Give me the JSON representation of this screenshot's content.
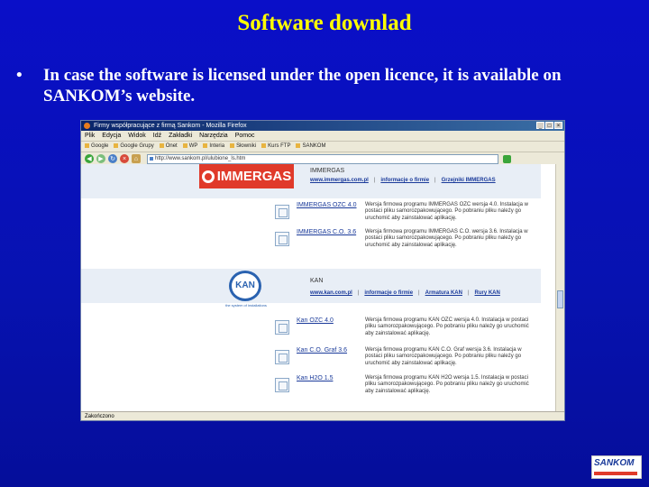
{
  "slide": {
    "title": "Software downlad",
    "bullet": "•",
    "bullet_text": "In case the software is licensed under the open licence, it is available on SANKOM’s website."
  },
  "browser": {
    "window_title": "Firmy współpracujące z firmą Sankom - Mozilla Firefox",
    "menu": [
      "Plik",
      "Edycja",
      "Widok",
      "Idź",
      "Zakładki",
      "Narzędzia",
      "Pomoc"
    ],
    "bookmarks": [
      "Google",
      "Google Grupy",
      "Onet",
      "WP",
      "Interia",
      "Słowniki",
      "Kurs FTP",
      "SANKOM"
    ],
    "url": "http://www.sankom.pl/ulubione_ls.htm",
    "status": "Zakończono"
  },
  "vendors": [
    {
      "name": "IMMERGAS",
      "logo_text": "IMMERGAS",
      "links": [
        "www.immergas.com.pl",
        "informacje o firmie",
        "Grzejniki IMMERGAS"
      ],
      "programs": [
        {
          "name": "IMMERGAS OZC 4.0",
          "desc": "Wersja firmowa programu IMMERGAS OZC wersja 4.0. Instalacja w postaci pliku samorozpakowującego. Po pobraniu pliku należy go uruchomić aby zainstalować aplikację."
        },
        {
          "name": "IMMERGAS C.O. 3.6",
          "desc": "Wersja firmowa programu IMMERGAS C.O. wersja 3.6. Instalacja w postaci pliku samorozpakowującego. Po pobraniu pliku należy go uruchomić aby zainstalować aplikację."
        }
      ]
    },
    {
      "name": "KAN",
      "logo_text": "KAN",
      "logo_sub": "the system of installations",
      "links": [
        "www.kan.com.pl",
        "informacje o firmie",
        "Armatura KAN",
        "Rury KAN"
      ],
      "programs": [
        {
          "name": "Kan OZC 4.0",
          "desc": "Wersja firmowa programu KAN OZC wersja 4.0. Instalacja w postaci pliku samorozpakowującego. Po pobraniu pliku należy go uruchomić aby zainstalować aplikację."
        },
        {
          "name": "Kan C.O. Graf 3.6",
          "desc": "Wersja firmowa programu KAN C.O. Graf wersja 3.6. Instalacja w postaci pliku samorozpakowującego. Po pobraniu pliku należy go uruchomić aby zainstalować aplikację."
        },
        {
          "name": "Kan H2O 1.5",
          "desc": "Wersja firmowa programu KAN H2O wersja 1.5. Instalacja w postaci pliku samorozpakowującego. Po pobraniu pliku należy go uruchomić aby zainstalować aplikację."
        }
      ]
    }
  ],
  "corner_logo": "SANKOM",
  "colors": {
    "title": "#ffff00",
    "background": "#0a0fc8",
    "immergas_red": "#e03a2a",
    "kan_blue": "#2a62b0"
  }
}
